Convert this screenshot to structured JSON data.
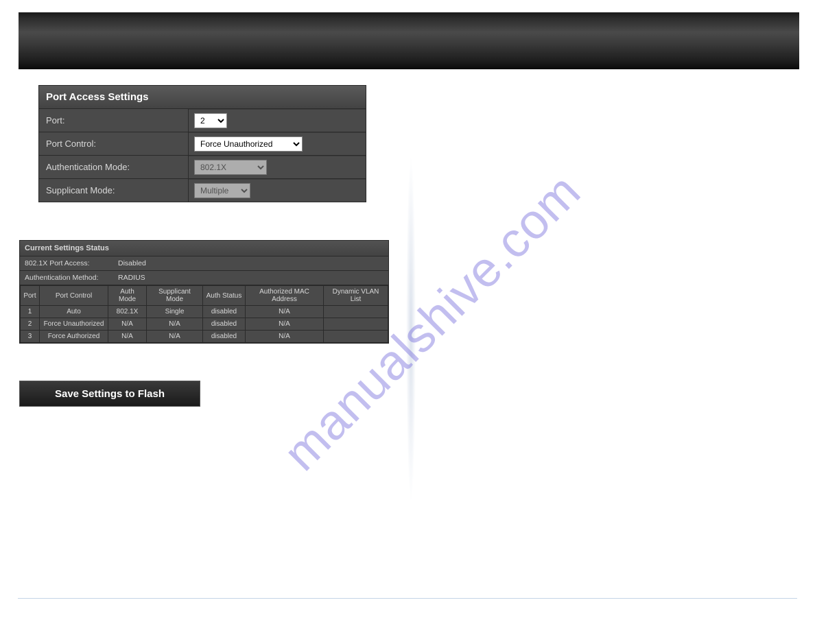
{
  "panel": {
    "title": "Port Access Settings",
    "rows": {
      "port": {
        "label": "Port:",
        "value": "2"
      },
      "control": {
        "label": "Port Control:",
        "value": "Force Unauthorized"
      },
      "auth": {
        "label": "Authentication Mode:",
        "value": "802.1X"
      },
      "supp": {
        "label": "Supplicant Mode:",
        "value": "Multiple"
      }
    }
  },
  "status": {
    "title": "Current Settings Status",
    "access": {
      "label": "802.1X Port Access:",
      "value": "Disabled"
    },
    "method": {
      "label": "Authentication Method:",
      "value": "RADIUS"
    },
    "headers": {
      "port": "Port",
      "control": "Port Control",
      "auth": "Auth Mode",
      "supp": "Supplicant Mode",
      "astat": "Auth Status",
      "mac": "Authorized MAC Address",
      "vlan": "Dynamic VLAN List"
    },
    "rows": [
      {
        "port": "1",
        "control": "Auto",
        "auth": "802.1X",
        "supp": "Single",
        "astat": "disabled",
        "mac": "N/A",
        "vlan": ""
      },
      {
        "port": "2",
        "control": "Force Unauthorized",
        "auth": "N/A",
        "supp": "N/A",
        "astat": "disabled",
        "mac": "N/A",
        "vlan": ""
      },
      {
        "port": "3",
        "control": "Force Authorized",
        "auth": "N/A",
        "supp": "N/A",
        "astat": "disabled",
        "mac": "N/A",
        "vlan": ""
      }
    ]
  },
  "save_label": "Save Settings to Flash",
  "watermark": "manualshive.com"
}
